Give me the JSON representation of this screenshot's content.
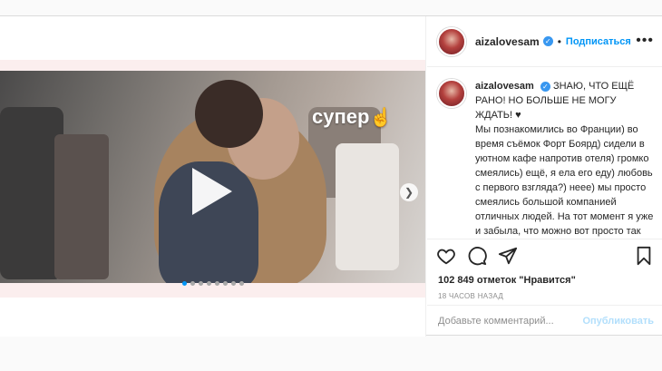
{
  "post": {
    "author": {
      "username": "aizalovesam",
      "verified": true
    },
    "header": {
      "separator": "•",
      "follow_label": "Подписаться",
      "more_label": "•••"
    },
    "media": {
      "sticker_text": "супер",
      "sticker_icon": "hand-icon",
      "carousel": {
        "slides": 8,
        "active_index": 0
      },
      "next_icon": "chevron-right-icon"
    },
    "caption": {
      "username": "aizalovesam",
      "headline": "ЗНАЮ, ЧТО ЕЩЁ РАНО! НО БОЛЬШЕ НЕ МОГУ ЖДАТЬ! ♥",
      "body": "Мы познакомились во Франции) во время съёмок Форт Боярд) сидели в уютном кафе напротив отеля) громко смеялись) ещё, я ела его еду) любовь с первого взгляда?) неее) мы просто смеялись большой компанией отличных людей. На тот момент я уже и забыла, что можно вот просто так вот быть. Я была"
    },
    "actions": {
      "like_icon": "heart-icon",
      "comment_icon": "comment-icon",
      "share_icon": "share-icon",
      "save_icon": "bookmark-icon"
    },
    "likes": "102 849 отметок \"Нравится\"",
    "timestamp": "18 ЧАСОВ НАЗАД",
    "comment": {
      "placeholder": "Добавьте комментарий...",
      "publish_label": "Опубликовать"
    },
    "colors": {
      "accent": "#0095f6",
      "publish_disabled": "#b2dffc",
      "verified": "#3897f0"
    }
  }
}
